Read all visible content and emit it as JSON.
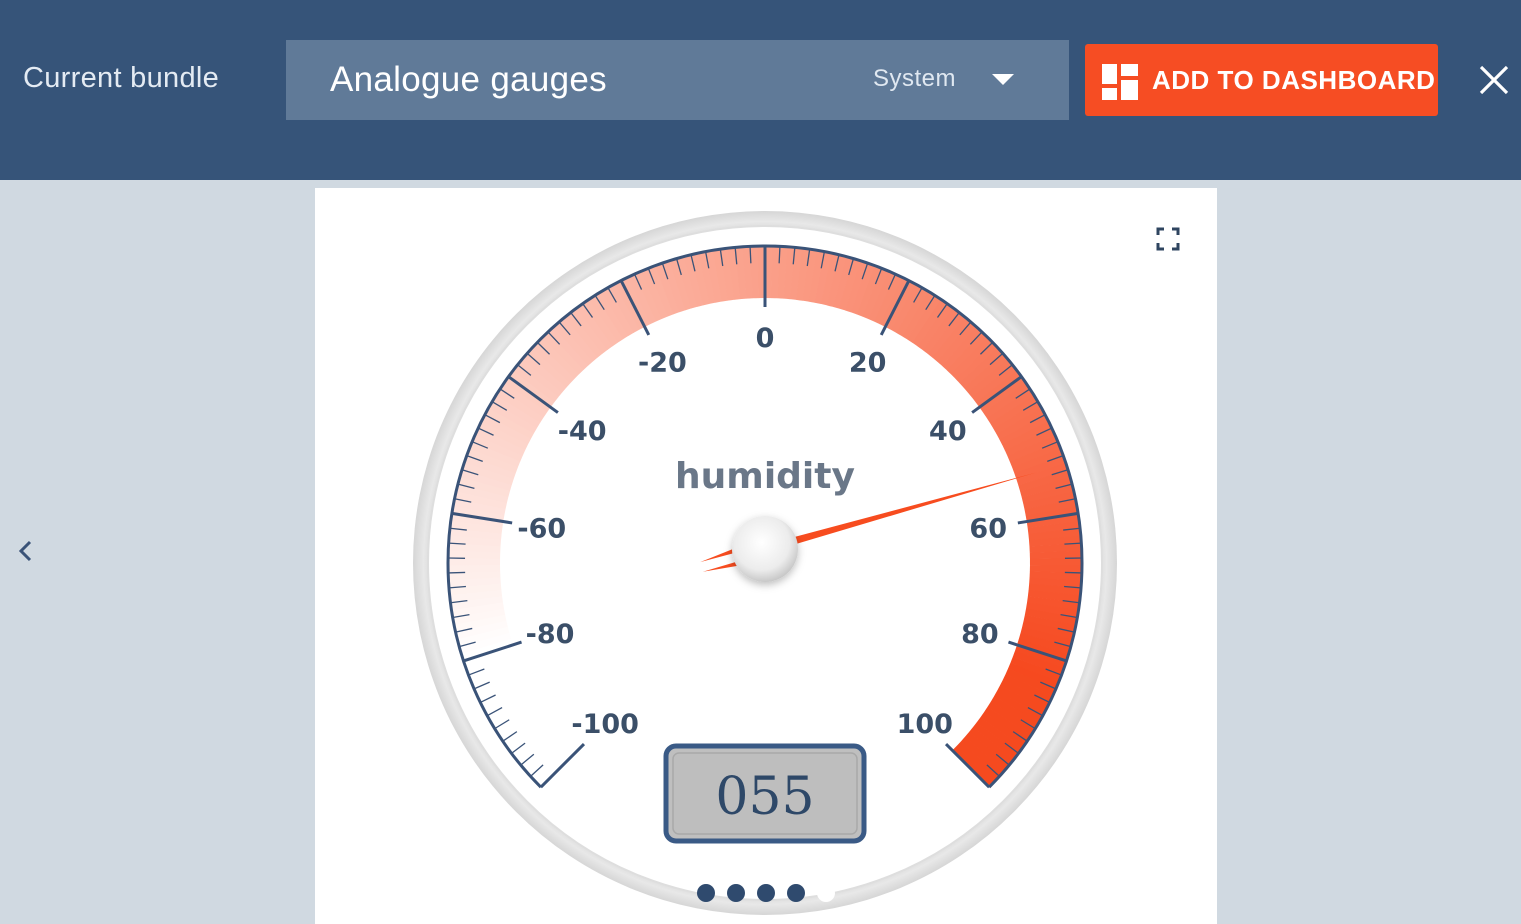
{
  "header": {
    "bundle_label": "Current bundle",
    "bundle_name": "Analogue gauges",
    "bundle_scope": "System",
    "add_button_label": "ADD TO DASHBOARD",
    "add_button_icon": "dashboard-icon",
    "close_icon": "close-icon"
  },
  "navigation": {
    "prev_icon": "chevron-left-icon",
    "fullscreen_icon": "fullscreen-icon",
    "carousel_pages": 5,
    "carousel_active_page": 5
  },
  "gauge": {
    "title": "humidity",
    "value": 55,
    "readout": "055",
    "min": -100,
    "max": 100,
    "major_step": 20,
    "minor_step": 2,
    "tick_labels": [
      "-100",
      "-80",
      "-60",
      "-40",
      "-20",
      "0",
      "20",
      "40",
      "60",
      "80",
      "100"
    ],
    "colors": {
      "band_start": "#ffffff",
      "band_end": "#f6481e",
      "band_peak": "#f54a1f",
      "needle": "#f74c1f",
      "ticks": "#3a5378",
      "readout_box": "#bfbfbf",
      "readout_border": "#3a5a86"
    }
  },
  "theme": {
    "header_bg": "#365479",
    "body_bg": "#d0d9e1",
    "select_bg": "#607a98",
    "accent": "#f64d23"
  }
}
